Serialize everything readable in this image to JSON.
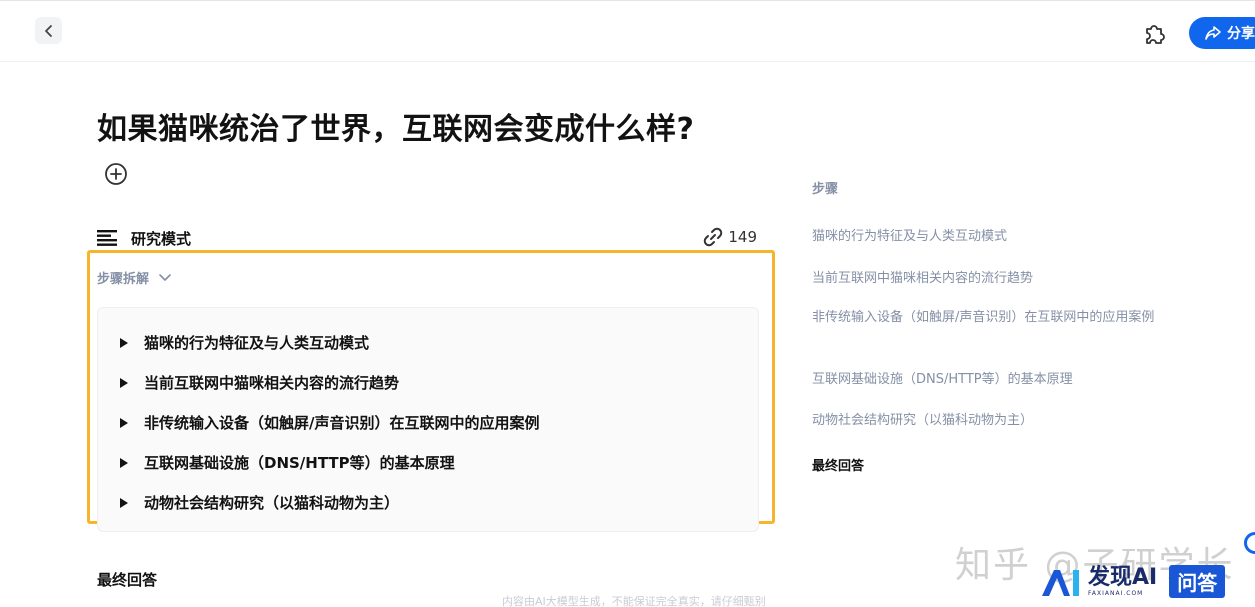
{
  "topbar": {
    "share_label": "分享"
  },
  "page": {
    "title": "如果猫咪统治了世界，互联网会变成什么样?"
  },
  "mode": {
    "label": "研究模式",
    "source_count": "149"
  },
  "steps": {
    "toggle_label": "步骤拆解",
    "items": [
      "猫咪的行为特征及与人类互动模式",
      "当前互联网中猫咪相关内容的流行趋势",
      "非传统输入设备（如触屏/声音识别）在互联网中的应用案例",
      "互联网基础设施（DNS/HTTP等）的基本原理",
      "动物社会结构研究（以猫科动物为主）"
    ]
  },
  "final_answer_label": "最终回答",
  "disclaimer": "内容由AI大模型生成，不能保证完全真实，请仔细甄别",
  "toc": {
    "title": "步骤",
    "items": [
      "猫咪的行为特征及与人类互动模式",
      "当前互联网中猫咪相关内容的流行趋势",
      "非传统输入设备（如触屏/声音识别）在互联网中的应用案例",
      "互联网基础设施（DNS/HTTP等）的基本原理",
      "动物社会结构研究（以猫科动物为主）"
    ],
    "final": "最终回答"
  },
  "watermark": {
    "text": "知乎 @子研学长",
    "brand_name": "发现AI",
    "brand_url": "FAXIANAI.COM",
    "qa_badge": "问答"
  },
  "colors": {
    "accent": "#1166ee",
    "highlight": "#f6b52a",
    "muted": "#8590a6"
  },
  "icons": {
    "back": "chevron-left-icon",
    "plugin": "puzzle-icon",
    "share": "share-arrow-icon",
    "add": "plus-circle-icon",
    "mode": "lines-icon",
    "link": "link-icon",
    "toggle": "chevron-down-icon",
    "step": "triangle-right-icon"
  }
}
